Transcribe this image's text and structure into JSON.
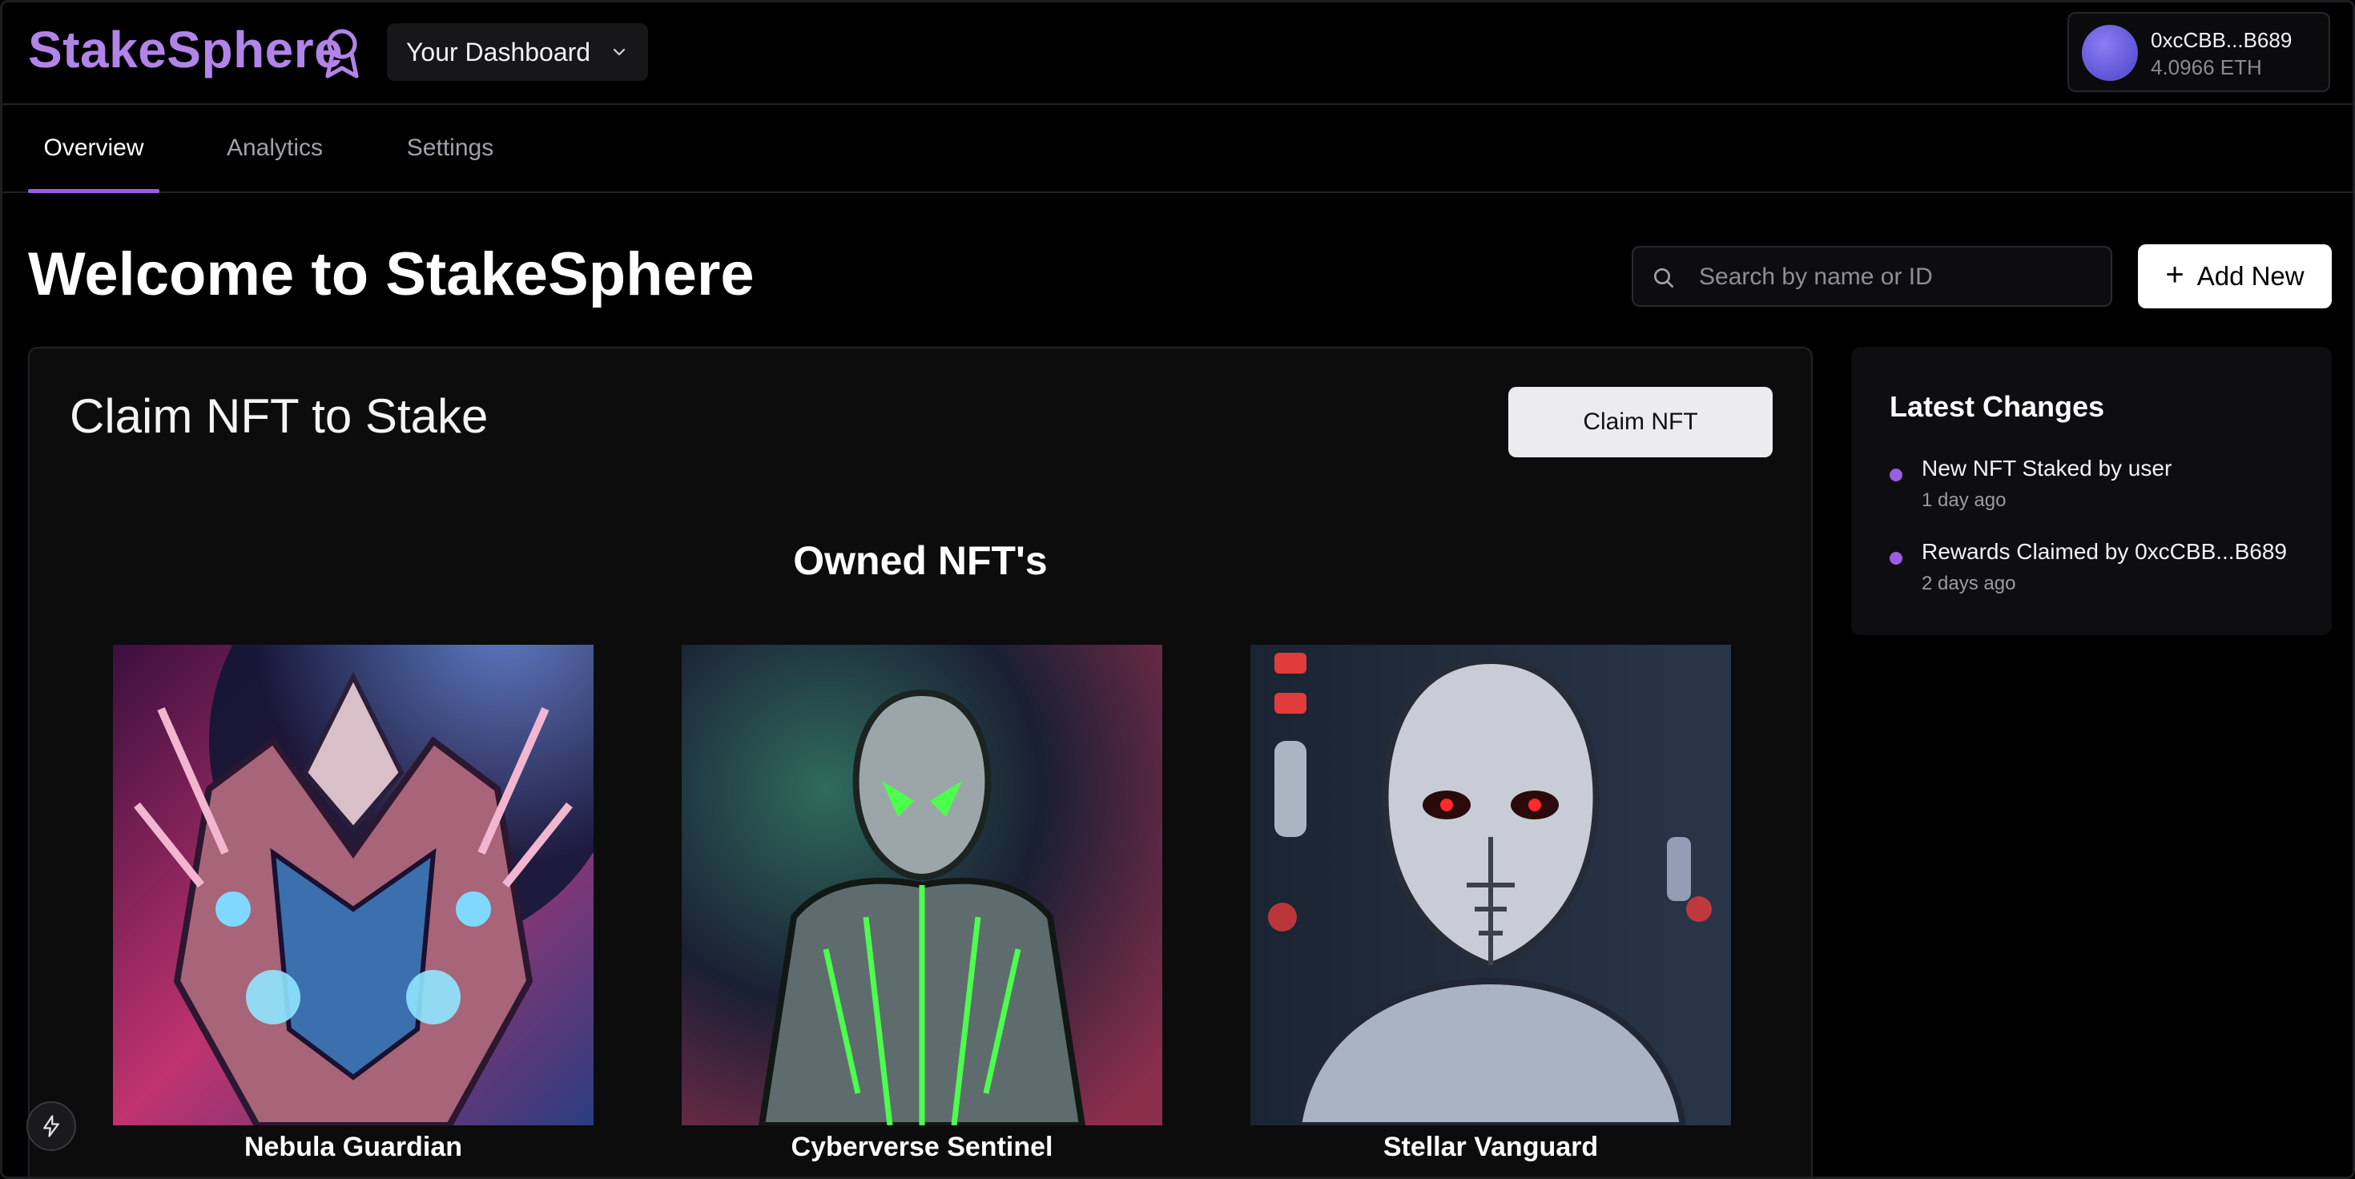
{
  "header": {
    "logo": "StakeSphere",
    "dashboard_select": "Your Dashboard",
    "wallet": {
      "address": "0xcCBB...B689",
      "balance": "4.0966 ETH"
    }
  },
  "tabs": [
    {
      "label": "Overview",
      "active": true
    },
    {
      "label": "Analytics",
      "active": false
    },
    {
      "label": "Settings",
      "active": false
    }
  ],
  "main": {
    "title": "Welcome to StakeSphere",
    "search_placeholder": "Search by name or ID",
    "add_new_label": "Add New"
  },
  "claim_card": {
    "title": "Claim NFT to Stake",
    "claim_button": "Claim NFT",
    "owned_heading": "Owned NFT's",
    "nfts": [
      {
        "name": "Nebula Guardian"
      },
      {
        "name": "Cyberverse Sentinel"
      },
      {
        "name": "Stellar Vanguard"
      }
    ]
  },
  "latest_changes": {
    "title": "Latest Changes",
    "items": [
      {
        "text": "New NFT Staked by user",
        "time": "1 day ago"
      },
      {
        "text": "Rewards Claimed by 0xcCBB...B689",
        "time": "2 days ago"
      }
    ]
  },
  "colors": {
    "accent": "#9b5de5",
    "logo": "#b283e8",
    "background": "#000000"
  }
}
